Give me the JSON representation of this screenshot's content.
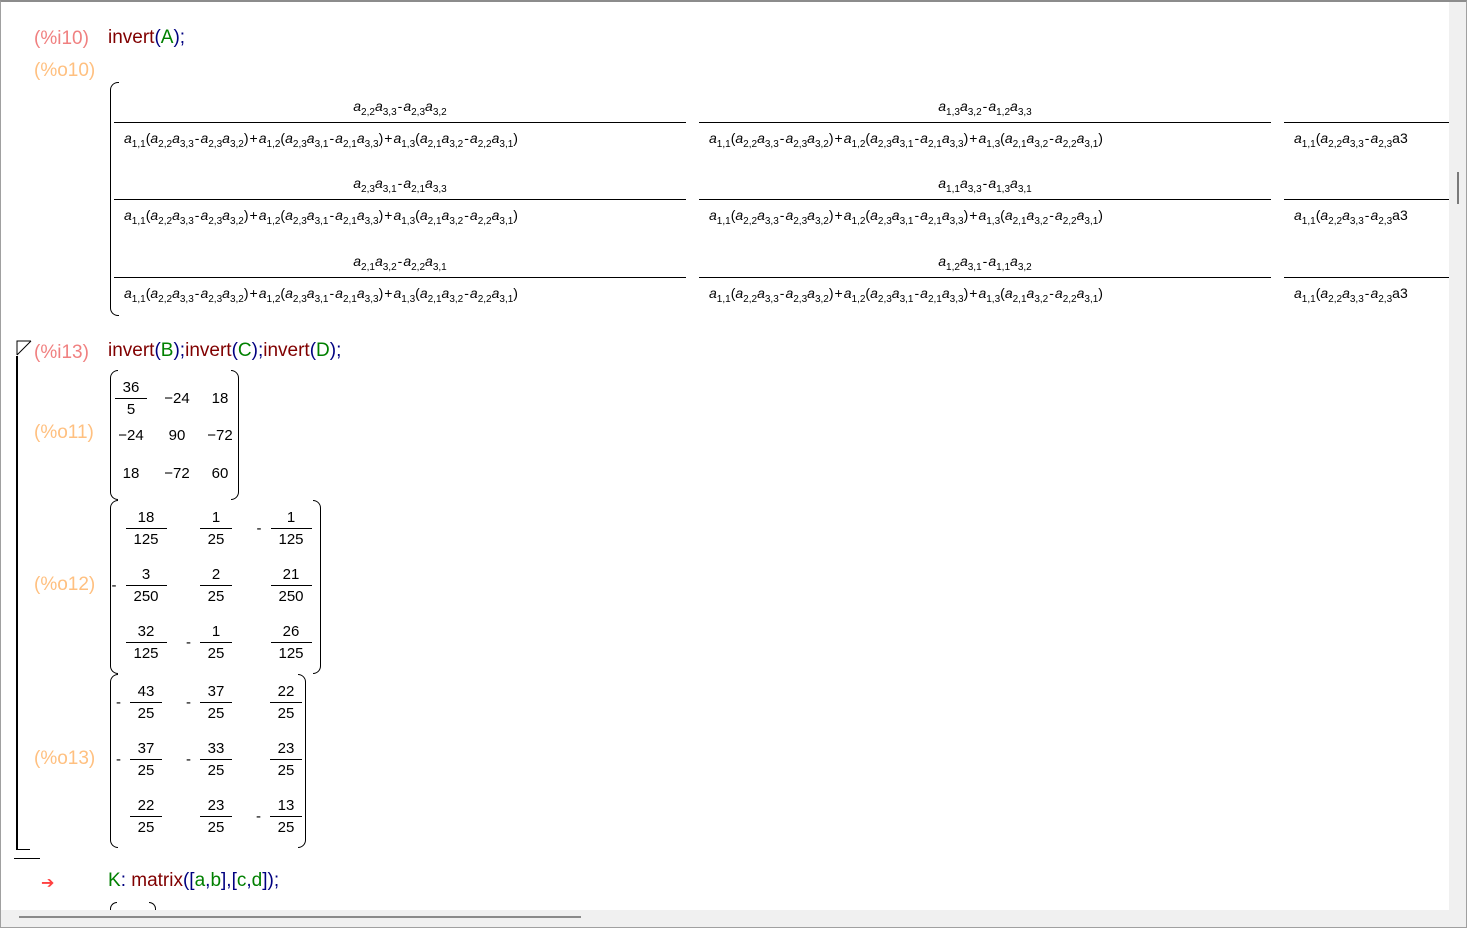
{
  "cells": [
    {
      "in_label": "(%i10)",
      "out_label": "(%o10)",
      "input": {
        "fn": "invert",
        "arg": "A",
        "end": ");"
      }
    },
    {
      "in_label": "(%i13)",
      "input": {
        "fn1": "invert",
        "arg1": "B",
        "fn2": "invert",
        "arg2": "C",
        "fn3": "invert",
        "arg3": "D",
        "end": ");"
      },
      "outputs": [
        {
          "label": "(%o11)",
          "rows": [
            [
              "36/5",
              "-24",
              "18"
            ],
            [
              "-24",
              "90",
              "-72"
            ],
            [
              "18",
              "-72",
              "60"
            ]
          ]
        },
        {
          "label": "(%o12)",
          "rows": [
            [
              "18/125",
              "1/25",
              "-1/125"
            ],
            [
              "-3/250",
              "2/25",
              "21/250"
            ],
            [
              "32/125",
              "-1/25",
              "26/125"
            ]
          ]
        },
        {
          "label": "(%o13)",
          "rows": [
            [
              "-43/25",
              "-37/25",
              "22/25"
            ],
            [
              "-37/25",
              "-33/25",
              "23/25"
            ],
            [
              "22/25",
              "23/25",
              "-13/25"
            ]
          ]
        }
      ]
    },
    {
      "prompt_symbol": "➔",
      "input": {
        "var": "K",
        "colon": ": ",
        "fn": "matrix",
        "open": "([",
        "a": "a",
        "b": "b",
        "mid": "],[",
        "c": "c",
        "d": "d",
        "end": "]);"
      }
    }
  ],
  "o10": {
    "numerators": [
      [
        "a22a33-a23a32",
        "a13a32-a12a33"
      ],
      [
        "a23a31-a21a33",
        "a11a33-a13a31"
      ],
      [
        "a21a32-a22a31",
        "a12a31-a11a32"
      ]
    ],
    "denominator": "a11(a22a33-a23a32)+a12(a23a31-a21a33)+a13(a21a32-a22a31)",
    "denominator_partial": "a11(a22a33-a23a3"
  },
  "text": {
    "comma": ",",
    "semicolon": ";",
    "open": "(",
    "close": ")"
  }
}
